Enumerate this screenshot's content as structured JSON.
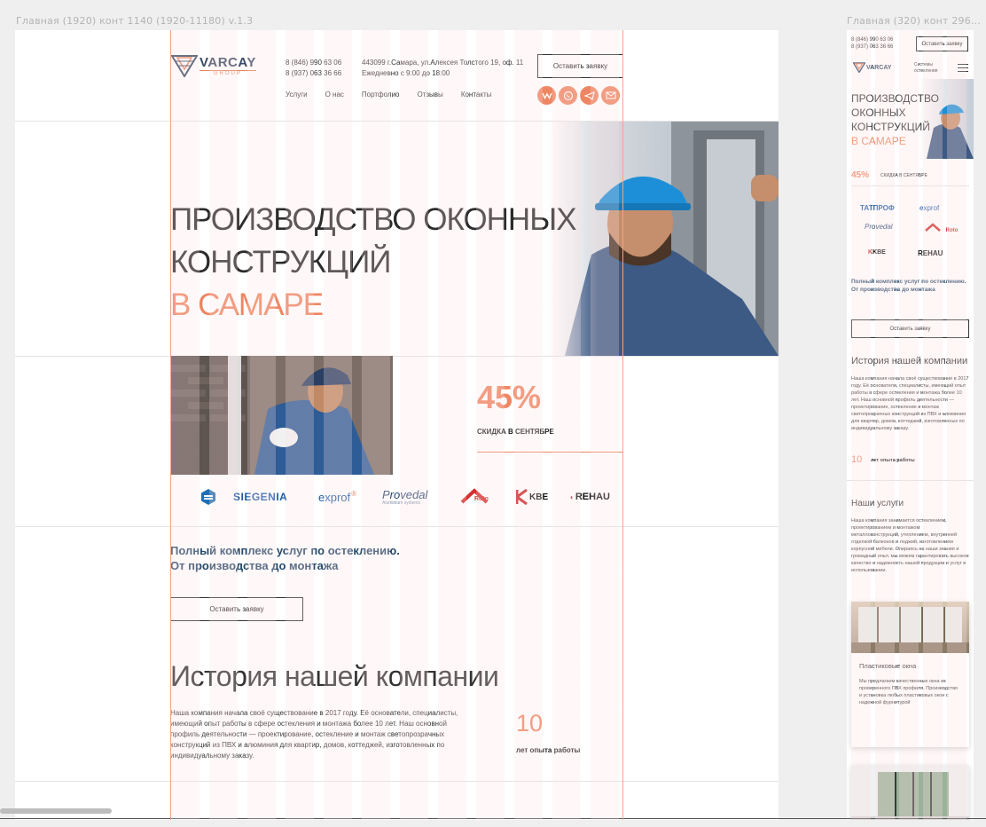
{
  "frames": {
    "desktop_label": "Главная (1920) конт 1140 (1920-11180) v.1.3",
    "mobile_label": "Главная (320) конт 296..."
  },
  "colors": {
    "accent": "#ee8663",
    "navy": "#254a6b",
    "text": "#2b2b2b"
  },
  "header": {
    "logo_name": "VARCAY",
    "logo_sub": "GROUP",
    "phones": [
      "8 (846) 990 63 06",
      "8 (937) 063 36 66"
    ],
    "address": "443099 г.Самара, ул.Алексея Толстого 19, оф. 11",
    "hours": "Ежедневно с 9:00 до 18:00",
    "cta": "Оставить заявку",
    "nav": [
      "Услуги",
      "О нас",
      "Портфолио",
      "Отзывы",
      "Контакты"
    ],
    "socials": [
      "vk-icon",
      "whatsapp-icon",
      "telegram-icon",
      "mail-icon"
    ]
  },
  "hero": {
    "title_line1": "ПРОИЗВОДСТВО ОКОННЫХ",
    "title_line2": "КОНСТРУКЦИЙ",
    "city": "В САМАРЕ"
  },
  "discount": {
    "value": "45%",
    "label": "СКИДКА В СЕНТЯБРЕ"
  },
  "brands": [
    "SIEGENIA",
    "exprof",
    "Provedal",
    "Roto",
    "KBE",
    "REHAU"
  ],
  "brands_sub": {
    "provedal": "Aluminium systems"
  },
  "services": {
    "tagline_line1": "Полный комплекс услуг по остеклению.",
    "tagline_line2": "От производства до монтажа",
    "cta": "Оставить заявку"
  },
  "history": {
    "title": "История нашей компании",
    "text": "Наша компания начала своё существование в 2017 году. Её основатели, специалисты, имеющий опыт работы в сфере остекления и монтажа более 10 лет. Наш основной профиль деятельности — проектирование, остекление и монтаж светопрозрачных конструкций из ПВХ и алюминия для квартир, домов, коттеджей, изготовленных по индивидуальному заказу.",
    "years_value": "10",
    "years_label": "лет опыта работы"
  },
  "mobile": {
    "phones": [
      "8 (846) 990 63 06",
      "8 (937) 063 36 66"
    ],
    "cta": "Оставить заявку",
    "logo_tag_line1": "Системы",
    "logo_tag_line2": "остекления",
    "title_lines": [
      "ПРОИЗВОДСТВО",
      "ОКОННЫХ",
      "КОНСТРУКЦИЙ"
    ],
    "city": "В САМАРЕ",
    "discount_value": "45%",
    "discount_label": "СКИДКА В СЕНТЯБРЕ",
    "brands": [
      "ТАТПРОФ",
      "exprof",
      "Provedal",
      "Roto",
      "KBE",
      "REHAU"
    ],
    "tagline": "Полный комплекс услуг по остеклению. От производства до монтажа",
    "history_title": "История нашей компании",
    "history_text": "Наша компания начала своё существование в 2017 году. Её основатели, специалисты, имеющий опыт работы в сфере остекления и монтажа более 10 лет. Наш основной профиль деятельности — проектирование, остекление и монтаж светопрозрачных конструкций из ПВХ и алюминия для квартир, домов, коттеджей, изготовленных по индивидуальному заказу.",
    "years_value": "10",
    "years_label": "лет опыта работы",
    "services_title": "Наши услуги",
    "services_text": "Наша компания занимается остеклением, проектированием и монтажом металлоконструкций, утеплением, внутренней отделкой балконов и лоджий, изготовлением корпусной мебели. Опираясь на наши знания и громадный опыт, мы можем гарантировать высокое качество и надежность нашей продукции и услуг в использовании.",
    "card_title": "Пластиковые окна",
    "card_text": "Мы предлагаем качественные окна из проверенного ПВХ профиля. Производство и установка любых пластиковых окон с надежной фурнитурой"
  }
}
